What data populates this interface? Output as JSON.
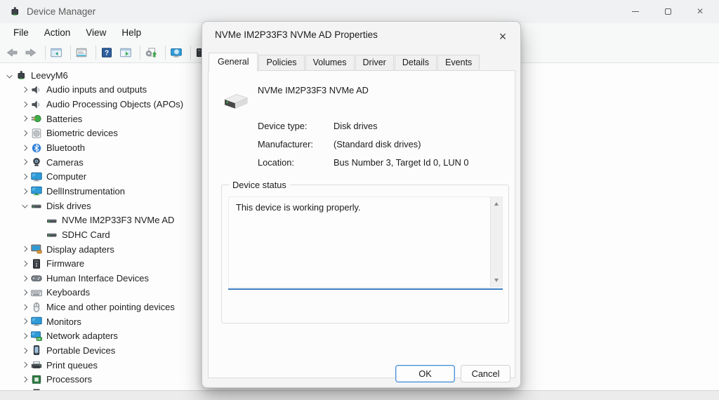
{
  "window": {
    "title": "Device Manager",
    "controls": [
      {
        "name": "minimize"
      },
      {
        "name": "maximize"
      },
      {
        "name": "close"
      }
    ]
  },
  "menu": {
    "items": [
      {
        "label": "File"
      },
      {
        "label": "Action"
      },
      {
        "label": "View"
      },
      {
        "label": "Help"
      }
    ]
  },
  "toolbar": {
    "items": [
      {
        "type": "button",
        "icon": "back-icon"
      },
      {
        "type": "button",
        "icon": "forward-icon"
      },
      {
        "type": "separator"
      },
      {
        "type": "button",
        "icon": "show-console-tree-icon"
      },
      {
        "type": "separator"
      },
      {
        "type": "button",
        "icon": "properties-icon"
      },
      {
        "type": "separator"
      },
      {
        "type": "button",
        "icon": "help-icon"
      },
      {
        "type": "button",
        "icon": "show-action-pane-icon"
      },
      {
        "type": "separator"
      },
      {
        "type": "button",
        "icon": "scan-hardware-changes-icon"
      },
      {
        "type": "separator"
      },
      {
        "type": "button",
        "icon": "search-computer-icon"
      },
      {
        "type": "separator"
      },
      {
        "type": "button",
        "icon": "update-driver-icon"
      }
    ]
  },
  "tree": {
    "items": [
      {
        "label": "LeevyM6",
        "level": 0,
        "expander": "expanded",
        "icon": "computer-device-icon"
      },
      {
        "label": "Audio inputs and outputs",
        "level": 1,
        "expander": "collapsed",
        "icon": "speaker-icon"
      },
      {
        "label": "Audio Processing Objects (APOs)",
        "level": 1,
        "expander": "collapsed",
        "icon": "speaker-icon"
      },
      {
        "label": "Batteries",
        "level": 1,
        "expander": "collapsed",
        "icon": "battery-icon"
      },
      {
        "label": "Biometric devices",
        "level": 1,
        "expander": "collapsed",
        "icon": "fingerprint-icon"
      },
      {
        "label": "Bluetooth",
        "level": 1,
        "expander": "collapsed",
        "icon": "bluetooth-icon"
      },
      {
        "label": "Cameras",
        "level": 1,
        "expander": "collapsed",
        "icon": "camera-icon"
      },
      {
        "label": "Computer",
        "level": 1,
        "expander": "collapsed",
        "icon": "monitor-icon"
      },
      {
        "label": "DellInstrumentation",
        "level": 1,
        "expander": "collapsed",
        "icon": "monitor-green-icon"
      },
      {
        "label": "Disk drives",
        "level": 1,
        "expander": "expanded",
        "icon": "disk-icon"
      },
      {
        "label": "NVMe IM2P33F3 NVMe AD",
        "level": 2,
        "expander": "none",
        "icon": "disk-icon"
      },
      {
        "label": "SDHC Card",
        "level": 2,
        "expander": "none",
        "icon": "disk-icon"
      },
      {
        "label": "Display adapters",
        "level": 1,
        "expander": "collapsed",
        "icon": "display-adapter-icon"
      },
      {
        "label": "Firmware",
        "level": 1,
        "expander": "collapsed",
        "icon": "firmware-icon"
      },
      {
        "label": "Human Interface Devices",
        "level": 1,
        "expander": "collapsed",
        "icon": "hid-icon"
      },
      {
        "label": "Keyboards",
        "level": 1,
        "expander": "collapsed",
        "icon": "keyboard-icon"
      },
      {
        "label": "Mice and other pointing devices",
        "level": 1,
        "expander": "collapsed",
        "icon": "mouse-icon"
      },
      {
        "label": "Monitors",
        "level": 1,
        "expander": "collapsed",
        "icon": "monitor-icon"
      },
      {
        "label": "Network adapters",
        "level": 1,
        "expander": "collapsed",
        "icon": "network-adapter-icon"
      },
      {
        "label": "Portable Devices",
        "level": 1,
        "expander": "collapsed",
        "icon": "portable-device-icon"
      },
      {
        "label": "Print queues",
        "level": 1,
        "expander": "collapsed",
        "icon": "printer-icon"
      },
      {
        "label": "Processors",
        "level": 1,
        "expander": "collapsed",
        "icon": "processor-icon"
      },
      {
        "label": "",
        "level": 1,
        "expander": "none",
        "icon": "partial-device-icon",
        "partial": true
      }
    ]
  },
  "dialog": {
    "title": "NVMe IM2P33F3 NVMe AD Properties",
    "tabs": [
      {
        "label": "General",
        "active": true
      },
      {
        "label": "Policies",
        "active": false
      },
      {
        "label": "Volumes",
        "active": false
      },
      {
        "label": "Driver",
        "active": false
      },
      {
        "label": "Details",
        "active": false
      },
      {
        "label": "Events",
        "active": false
      }
    ],
    "device_name": "NVMe IM2P33F3 NVMe AD",
    "device_icon": "disk-drive-3d-icon",
    "properties": [
      {
        "label": "Device type:",
        "value": "Disk drives"
      },
      {
        "label": "Manufacturer:",
        "value": "(Standard disk drives)"
      },
      {
        "label": "Location:",
        "value": "Bus Number 3, Target Id 0, LUN 0"
      }
    ],
    "status_group": {
      "label": "Device status",
      "text": "This device is working properly."
    },
    "buttons": {
      "ok": "OK",
      "cancel": "Cancel"
    }
  },
  "colors": {
    "focus_line_blue": "#3f7fc1",
    "ok_button_border": "#4a90d8",
    "monitor_blue": "#2d9bd8",
    "success_green": "#3fae49"
  }
}
